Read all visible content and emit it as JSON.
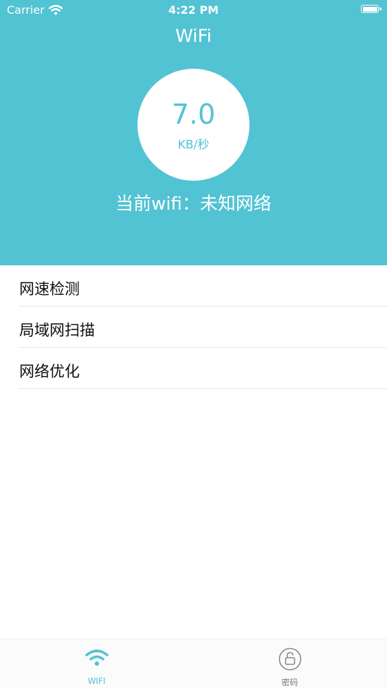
{
  "status_bar": {
    "carrier": "Carrier",
    "time": "4:22 PM",
    "icons": [
      "wifi-signal-icon",
      "battery-icon"
    ]
  },
  "nav": {
    "title": "WiFi"
  },
  "speed": {
    "value": "7.0",
    "unit": "KB/秒"
  },
  "current_wifi": "当前wifi：未知网络",
  "menu": {
    "items": [
      {
        "label": "网速检测"
      },
      {
        "label": "局域网扫描"
      },
      {
        "label": "网络优化"
      }
    ]
  },
  "tabbar": {
    "tabs": [
      {
        "label": "WIFI",
        "icon": "wifi-icon",
        "active": true
      },
      {
        "label": "密码",
        "icon": "lock-icon",
        "active": false
      }
    ]
  },
  "colors": {
    "accent": "#52c3d3",
    "divider": "#e4e4e4"
  }
}
